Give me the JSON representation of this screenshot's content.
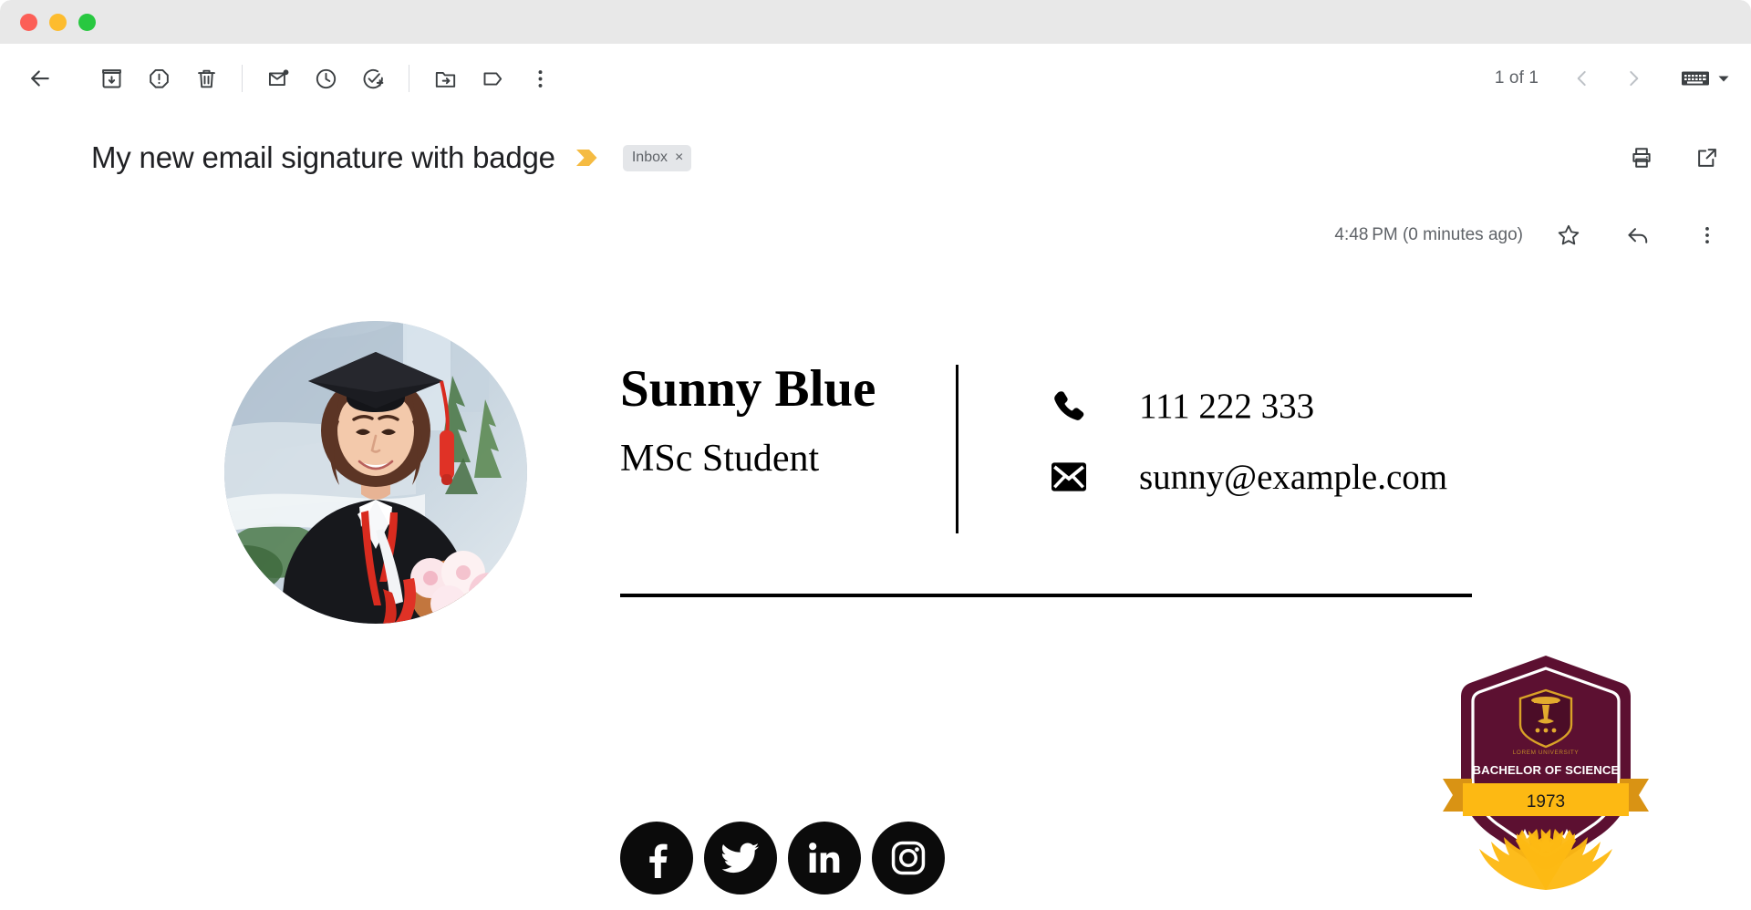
{
  "window": {
    "traffic_lights": [
      {
        "name": "close",
        "color": "#fc5f57"
      },
      {
        "name": "minimize",
        "color": "#fdbc2e"
      },
      {
        "name": "maximize",
        "color": "#28c840"
      }
    ]
  },
  "toolbar": {
    "back_label": "Back to Inbox",
    "archive_label": "Archive",
    "spam_label": "Report spam",
    "delete_label": "Delete",
    "unread_label": "Mark as unread",
    "snooze_label": "Snooze",
    "tasks_label": "Add to tasks",
    "move_label": "Move to",
    "labels_label": "Labels",
    "more_label": "More",
    "page_count": "1 of 1",
    "prev_label": "Newer",
    "next_label": "Older",
    "keyboard_label": "Input tools"
  },
  "email": {
    "subject": "My new email signature with badge",
    "label_chip": "Inbox",
    "label_chip_remove": "×",
    "print_label": "Print all",
    "popout_label": "Open in new window",
    "timestamp": "4:48 PM (0 minutes ago)",
    "star_label": "Star",
    "reply_label": "Reply",
    "more_label": "More"
  },
  "signature": {
    "photo_alt": "Graduate in cap and gown holding flowers",
    "name": "Sunny Blue",
    "role": "MSc Student",
    "contacts": [
      {
        "icon": "phone-icon",
        "value": "111 222 333"
      },
      {
        "icon": "envelope-icon",
        "value": "sunny@example.com"
      }
    ],
    "socials": [
      {
        "name": "facebook",
        "label": "Facebook"
      },
      {
        "name": "twitter",
        "label": "Twitter"
      },
      {
        "name": "linkedin",
        "label": "LinkedIn"
      },
      {
        "name": "instagram",
        "label": "Instagram"
      }
    ],
    "badge": {
      "crest_caption": "LOREM UNIVERSITY",
      "degree": "BACHELOR OF SCIENCE",
      "year": "1973",
      "star_count": 3,
      "colors": {
        "maroon": "#5c1031",
        "gold": "#fdb913",
        "gold_dark": "#d99314",
        "white": "#ffffff"
      }
    }
  }
}
